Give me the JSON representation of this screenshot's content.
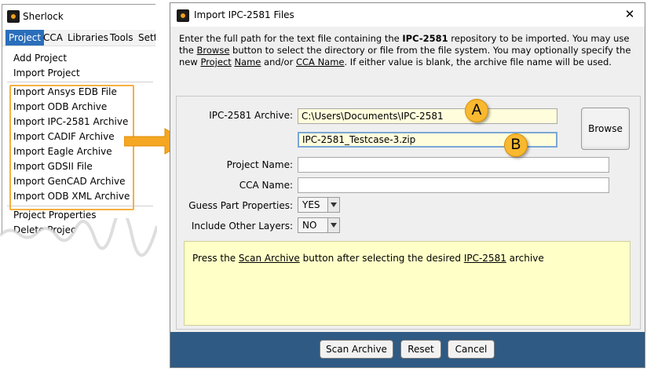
{
  "left_window": {
    "title": "Sherlock",
    "menubar": [
      "Project",
      "CCA",
      "Libraries",
      "Tools",
      "Sett"
    ],
    "items_top": [
      "Add Project",
      "Import Project"
    ],
    "items_import": [
      "Import  Ansys EDB File",
      "Import ODB Archive",
      "Import IPC-2581 Archive",
      "Import CADIF Archive",
      "Import Eagle Archive",
      "Import GDSII File",
      "Import GenCAD Archive",
      "Import ODB XML Archive"
    ],
    "items_bottom": [
      "Project Properties",
      "Delete Project"
    ]
  },
  "dialog": {
    "title": "Import IPC-2581 Files",
    "close_icon": "close-icon",
    "instructions": {
      "p1": "Enter the full path for the text file containing the ",
      "bold": "IPC-2581",
      "p2": " repository to be imported. You may use the",
      "browse_word": "Browse",
      "p3": " button to select the directory or file from the file system. You may optionally specify the new ",
      "project_word": "Project",
      "name_word": "Name",
      "p4": " and/or ",
      "cca_word": "CCA Name",
      "p5": ". If either value is blank, the archive file name will be used."
    },
    "form": {
      "archive_label": "IPC-2581 Archive:",
      "archive_dir": "C:\\Users\\Documents\\IPC-2581",
      "archive_file": "IPC-2581_Testcase-3.zip",
      "browse_label": "Browse",
      "project_name_label": "Project Name:",
      "project_name_value": "",
      "cca_name_label": "CCA Name:",
      "cca_name_value": "",
      "guess_label": "Guess Part Properties:",
      "guess_value": "YES",
      "layers_label": "Include Other Layers:",
      "layers_value": "NO"
    },
    "message": {
      "m1": "Press the ",
      "scan_word": "Scan Archive",
      "m2": " button after selecting the desired ",
      "ipc_word": "IPC-2581",
      "m3": " archive"
    },
    "buttons": {
      "scan": "Scan Archive",
      "reset": "Reset",
      "cancel": "Cancel"
    }
  },
  "callouts": {
    "a": "A",
    "b": "B"
  },
  "colors": {
    "highlight": "#f4b040",
    "arrow": "#f5a623",
    "footer": "#2f5a83",
    "field_yellow": "#fffddc",
    "message_bg": "#ffffc8"
  }
}
